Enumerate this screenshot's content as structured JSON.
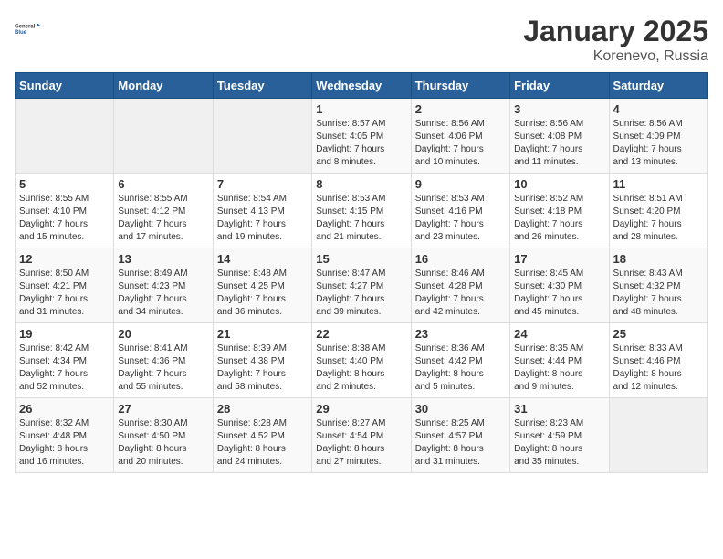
{
  "header": {
    "logo_general": "General",
    "logo_blue": "Blue",
    "month": "January 2025",
    "location": "Korenevo, Russia"
  },
  "days_of_week": [
    "Sunday",
    "Monday",
    "Tuesday",
    "Wednesday",
    "Thursday",
    "Friday",
    "Saturday"
  ],
  "weeks": [
    [
      {
        "day": "",
        "info": ""
      },
      {
        "day": "",
        "info": ""
      },
      {
        "day": "",
        "info": ""
      },
      {
        "day": "1",
        "info": "Sunrise: 8:57 AM\nSunset: 4:05 PM\nDaylight: 7 hours\nand 8 minutes."
      },
      {
        "day": "2",
        "info": "Sunrise: 8:56 AM\nSunset: 4:06 PM\nDaylight: 7 hours\nand 10 minutes."
      },
      {
        "day": "3",
        "info": "Sunrise: 8:56 AM\nSunset: 4:08 PM\nDaylight: 7 hours\nand 11 minutes."
      },
      {
        "day": "4",
        "info": "Sunrise: 8:56 AM\nSunset: 4:09 PM\nDaylight: 7 hours\nand 13 minutes."
      }
    ],
    [
      {
        "day": "5",
        "info": "Sunrise: 8:55 AM\nSunset: 4:10 PM\nDaylight: 7 hours\nand 15 minutes."
      },
      {
        "day": "6",
        "info": "Sunrise: 8:55 AM\nSunset: 4:12 PM\nDaylight: 7 hours\nand 17 minutes."
      },
      {
        "day": "7",
        "info": "Sunrise: 8:54 AM\nSunset: 4:13 PM\nDaylight: 7 hours\nand 19 minutes."
      },
      {
        "day": "8",
        "info": "Sunrise: 8:53 AM\nSunset: 4:15 PM\nDaylight: 7 hours\nand 21 minutes."
      },
      {
        "day": "9",
        "info": "Sunrise: 8:53 AM\nSunset: 4:16 PM\nDaylight: 7 hours\nand 23 minutes."
      },
      {
        "day": "10",
        "info": "Sunrise: 8:52 AM\nSunset: 4:18 PM\nDaylight: 7 hours\nand 26 minutes."
      },
      {
        "day": "11",
        "info": "Sunrise: 8:51 AM\nSunset: 4:20 PM\nDaylight: 7 hours\nand 28 minutes."
      }
    ],
    [
      {
        "day": "12",
        "info": "Sunrise: 8:50 AM\nSunset: 4:21 PM\nDaylight: 7 hours\nand 31 minutes."
      },
      {
        "day": "13",
        "info": "Sunrise: 8:49 AM\nSunset: 4:23 PM\nDaylight: 7 hours\nand 34 minutes."
      },
      {
        "day": "14",
        "info": "Sunrise: 8:48 AM\nSunset: 4:25 PM\nDaylight: 7 hours\nand 36 minutes."
      },
      {
        "day": "15",
        "info": "Sunrise: 8:47 AM\nSunset: 4:27 PM\nDaylight: 7 hours\nand 39 minutes."
      },
      {
        "day": "16",
        "info": "Sunrise: 8:46 AM\nSunset: 4:28 PM\nDaylight: 7 hours\nand 42 minutes."
      },
      {
        "day": "17",
        "info": "Sunrise: 8:45 AM\nSunset: 4:30 PM\nDaylight: 7 hours\nand 45 minutes."
      },
      {
        "day": "18",
        "info": "Sunrise: 8:43 AM\nSunset: 4:32 PM\nDaylight: 7 hours\nand 48 minutes."
      }
    ],
    [
      {
        "day": "19",
        "info": "Sunrise: 8:42 AM\nSunset: 4:34 PM\nDaylight: 7 hours\nand 52 minutes."
      },
      {
        "day": "20",
        "info": "Sunrise: 8:41 AM\nSunset: 4:36 PM\nDaylight: 7 hours\nand 55 minutes."
      },
      {
        "day": "21",
        "info": "Sunrise: 8:39 AM\nSunset: 4:38 PM\nDaylight: 7 hours\nand 58 minutes."
      },
      {
        "day": "22",
        "info": "Sunrise: 8:38 AM\nSunset: 4:40 PM\nDaylight: 8 hours\nand 2 minutes."
      },
      {
        "day": "23",
        "info": "Sunrise: 8:36 AM\nSunset: 4:42 PM\nDaylight: 8 hours\nand 5 minutes."
      },
      {
        "day": "24",
        "info": "Sunrise: 8:35 AM\nSunset: 4:44 PM\nDaylight: 8 hours\nand 9 minutes."
      },
      {
        "day": "25",
        "info": "Sunrise: 8:33 AM\nSunset: 4:46 PM\nDaylight: 8 hours\nand 12 minutes."
      }
    ],
    [
      {
        "day": "26",
        "info": "Sunrise: 8:32 AM\nSunset: 4:48 PM\nDaylight: 8 hours\nand 16 minutes."
      },
      {
        "day": "27",
        "info": "Sunrise: 8:30 AM\nSunset: 4:50 PM\nDaylight: 8 hours\nand 20 minutes."
      },
      {
        "day": "28",
        "info": "Sunrise: 8:28 AM\nSunset: 4:52 PM\nDaylight: 8 hours\nand 24 minutes."
      },
      {
        "day": "29",
        "info": "Sunrise: 8:27 AM\nSunset: 4:54 PM\nDaylight: 8 hours\nand 27 minutes."
      },
      {
        "day": "30",
        "info": "Sunrise: 8:25 AM\nSunset: 4:57 PM\nDaylight: 8 hours\nand 31 minutes."
      },
      {
        "day": "31",
        "info": "Sunrise: 8:23 AM\nSunset: 4:59 PM\nDaylight: 8 hours\nand 35 minutes."
      },
      {
        "day": "",
        "info": ""
      }
    ]
  ]
}
